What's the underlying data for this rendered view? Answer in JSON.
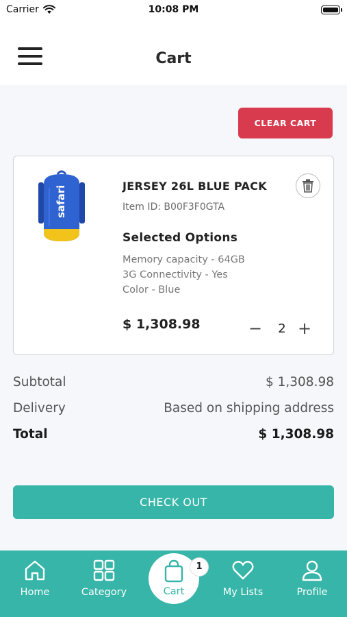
{
  "status_bar": {
    "carrier": "Carrier",
    "time": "10:08 PM"
  },
  "header": {
    "title": "Cart"
  },
  "actions": {
    "clear_cart": "CLEAR CART"
  },
  "cart_item": {
    "name": "JERSEY 26L BLUE PACK",
    "item_id": "Item ID: B00F3F0GTA",
    "image_brand": "safari",
    "options_title": "Selected Options",
    "options": [
      "Memory capacity - 64GB",
      "3G Connectivity - Yes",
      "Color - Blue"
    ],
    "price": "$ 1,308.98",
    "quantity": "2",
    "minus": "−",
    "plus": "+"
  },
  "summary": {
    "subtotal_label": "Subtotal",
    "subtotal_value": "$ 1,308.98",
    "delivery_label": "Delivery",
    "delivery_value": "Based on shipping address",
    "total_label": "Total",
    "total_value": "$ 1,308.98"
  },
  "checkout": {
    "label": "CHECK OUT"
  },
  "tabbar": {
    "tabs": [
      {
        "label": "Home",
        "icon": "home-icon"
      },
      {
        "label": "Category",
        "icon": "grid-icon"
      },
      {
        "label": "Cart",
        "icon": "bag-icon",
        "active": true
      },
      {
        "label": "My Lists",
        "icon": "heart-icon"
      },
      {
        "label": "Profile",
        "icon": "user-icon"
      }
    ],
    "cart_badge": "1"
  },
  "colors": {
    "accent": "#36b5a8",
    "danger": "#d93b4e"
  }
}
